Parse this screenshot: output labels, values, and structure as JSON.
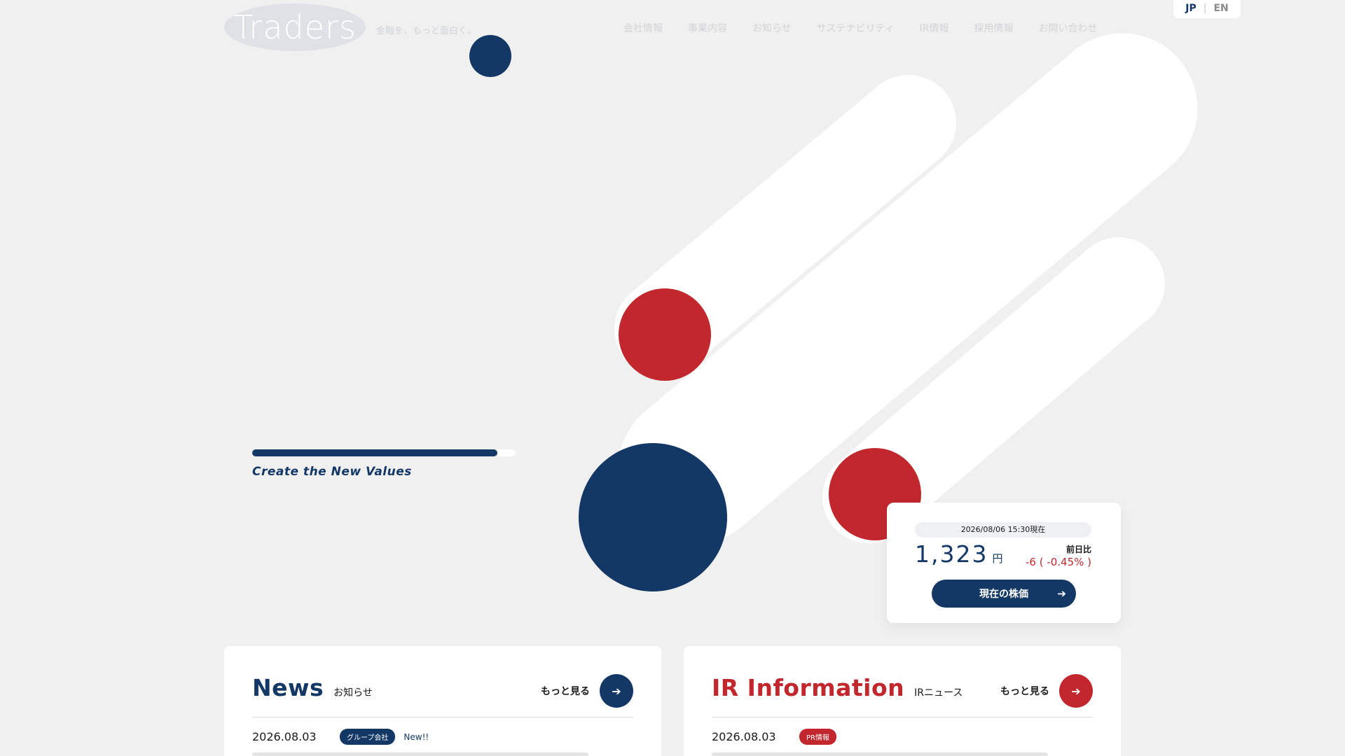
{
  "header": {
    "logo_text": "Traders",
    "tagline": "金融を、もっと面白く。",
    "nav": [
      "会社情報",
      "事業内容",
      "お知らせ",
      "サステナビリティ",
      "IR情報",
      "採用情報",
      "お問い合わせ"
    ],
    "lang": {
      "jp": "JP",
      "separator": "|",
      "en": "EN"
    }
  },
  "hero": {
    "slogan": "Create the New Values",
    "slide_progress": 0.93
  },
  "stock": {
    "timestamp": "2026/08/06 15:30現在",
    "price": "1,323",
    "unit": "円",
    "change_label": "前日比",
    "change_value": "-6 ( -0.45% )",
    "button_label": "現在の株価",
    "button_icon": "arrow-right-icon"
  },
  "news": {
    "title_en": "News",
    "title_ja": "お知らせ",
    "more_label": "もっと見る",
    "more_icon": "arrow-right-icon",
    "entry": {
      "date": "2026.08.03",
      "badge": "グループ会社",
      "new_mark": "New!!"
    }
  },
  "ir": {
    "title_en": "IR Information",
    "title_ja": "IRニュース",
    "more_label": "もっと見る",
    "more_icon": "arrow-right-icon",
    "entry": {
      "date": "2026.08.03",
      "badge": "PR情報"
    }
  },
  "colors": {
    "navy": "#143866",
    "red": "#c1272d",
    "background": "#f0f0f0"
  }
}
